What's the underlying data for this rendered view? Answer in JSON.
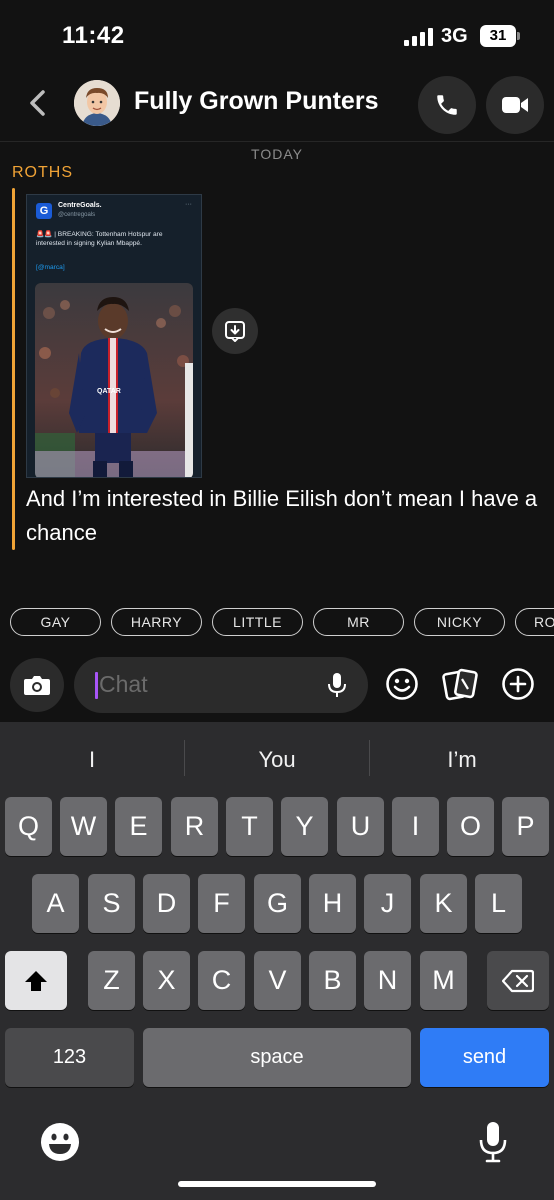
{
  "status": {
    "time": "11:42",
    "network": "3G",
    "battery": "31"
  },
  "header": {
    "back_icon": "chevron-left-icon",
    "title": "Fully Grown Punters",
    "call_icon": "phone-icon",
    "video_icon": "video-camera-icon"
  },
  "chat": {
    "day_label": "TODAY",
    "sender": "ROTHS",
    "accent_color": "#f0a336",
    "tweet": {
      "account_name": "CentreGoals.",
      "handle": "@centregoals",
      "logo_letter": "G",
      "more": "···",
      "text": "🚨🚨 | BREAKING: Tottenham Hotspur are interested in signing Kylian Mbappé.",
      "link": "[@marca]"
    },
    "message": "And I’m interested in Billie Eilish don’t mean I have a chance"
  },
  "chips": [
    "GAY",
    "HARRY",
    "LITTLE",
    "MR",
    "NICKY",
    "RO"
  ],
  "composer": {
    "placeholder": "Chat",
    "caret_color": "#a855f7"
  },
  "keyboard": {
    "suggestions": [
      "I",
      "You",
      "I’m"
    ],
    "row1": [
      "Q",
      "W",
      "E",
      "R",
      "T",
      "Y",
      "U",
      "I",
      "O",
      "P"
    ],
    "row2": [
      "A",
      "S",
      "D",
      "F",
      "G",
      "H",
      "J",
      "K",
      "L"
    ],
    "row3": [
      "Z",
      "X",
      "C",
      "V",
      "B",
      "N",
      "M"
    ],
    "numbers_label": "123",
    "space_label": "space",
    "send_label": "send",
    "send_color": "#2f7cf6"
  }
}
